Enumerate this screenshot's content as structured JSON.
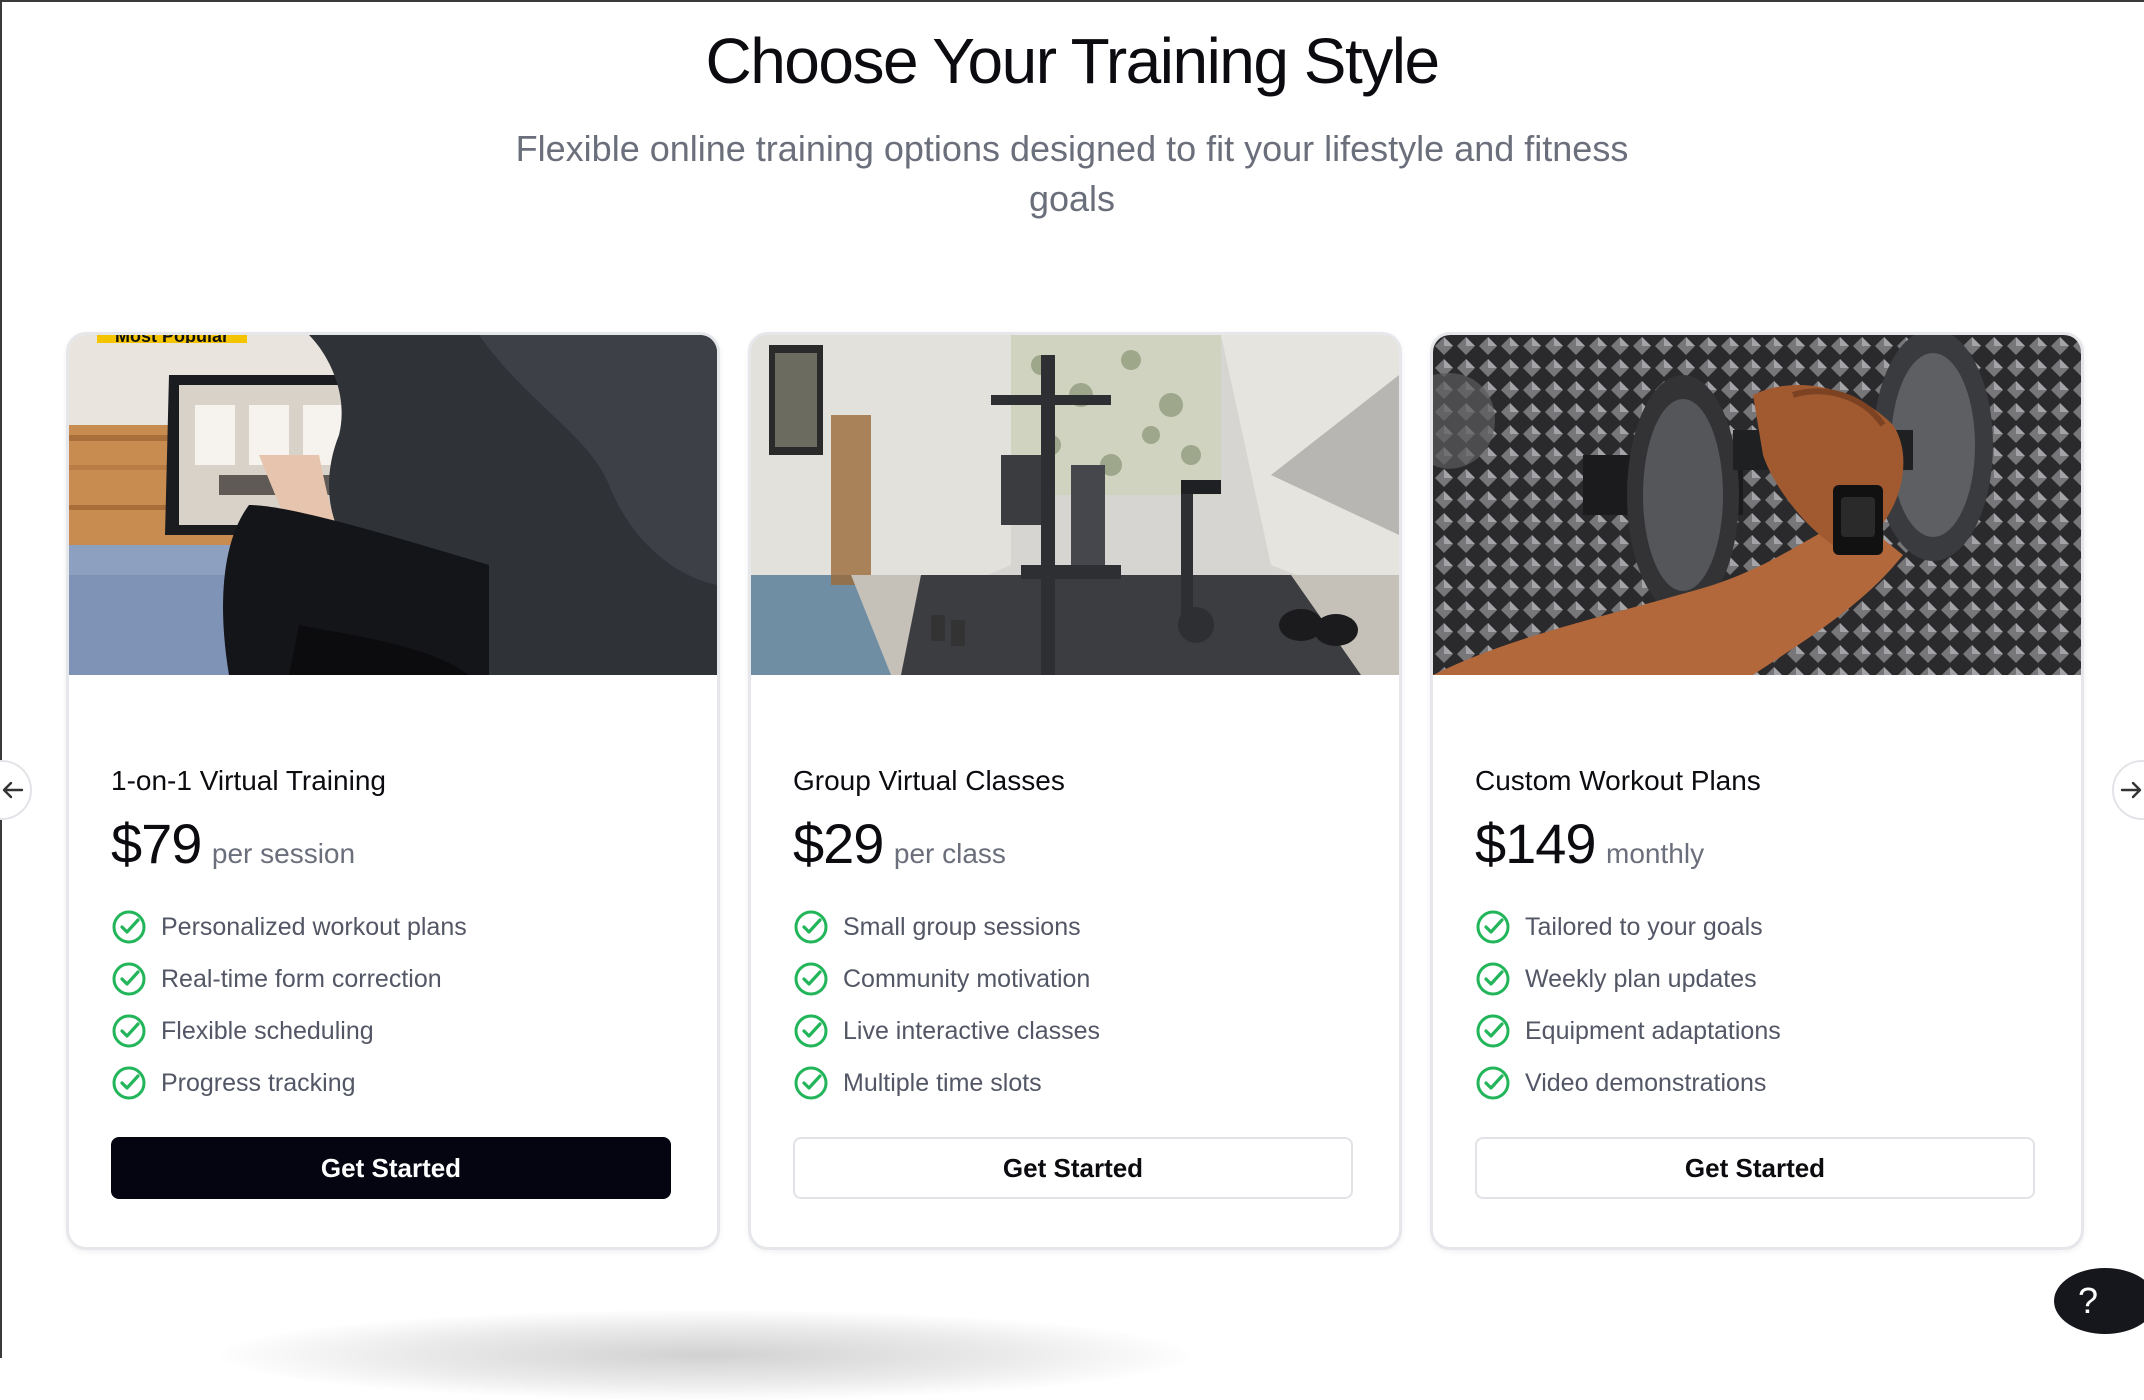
{
  "section": {
    "title": "Choose Your Training Style",
    "subtitle": "Flexible online training options designed to fit your lifestyle and fitness goals"
  },
  "plans": [
    {
      "badge": "Most Popular",
      "name": "1-on-1 Virtual Training",
      "price": "$79",
      "unit": "per session",
      "features": [
        "Personalized workout plans",
        "Real-time form correction",
        "Flexible scheduling",
        "Progress tracking"
      ],
      "cta": "Get Started"
    },
    {
      "name": "Group Virtual Classes",
      "price": "$29",
      "unit": "per class",
      "features": [
        "Small group sessions",
        "Community motivation",
        "Live interactive classes",
        "Multiple time slots"
      ],
      "cta": "Get Started"
    },
    {
      "name": "Custom Workout Plans",
      "price": "$149",
      "unit": "monthly",
      "features": [
        "Tailored to your goals",
        "Weekly plan updates",
        "Equipment adaptations",
        "Video demonstrations"
      ],
      "cta": "Get Started"
    }
  ],
  "help": {
    "label": "?"
  },
  "icons": {
    "check": "check-circle-icon",
    "prev": "arrow-left-icon",
    "next": "arrow-right-icon"
  },
  "colors": {
    "check_green": "#22b55a",
    "primary_button": "#050512",
    "badge": "#f5c400"
  }
}
